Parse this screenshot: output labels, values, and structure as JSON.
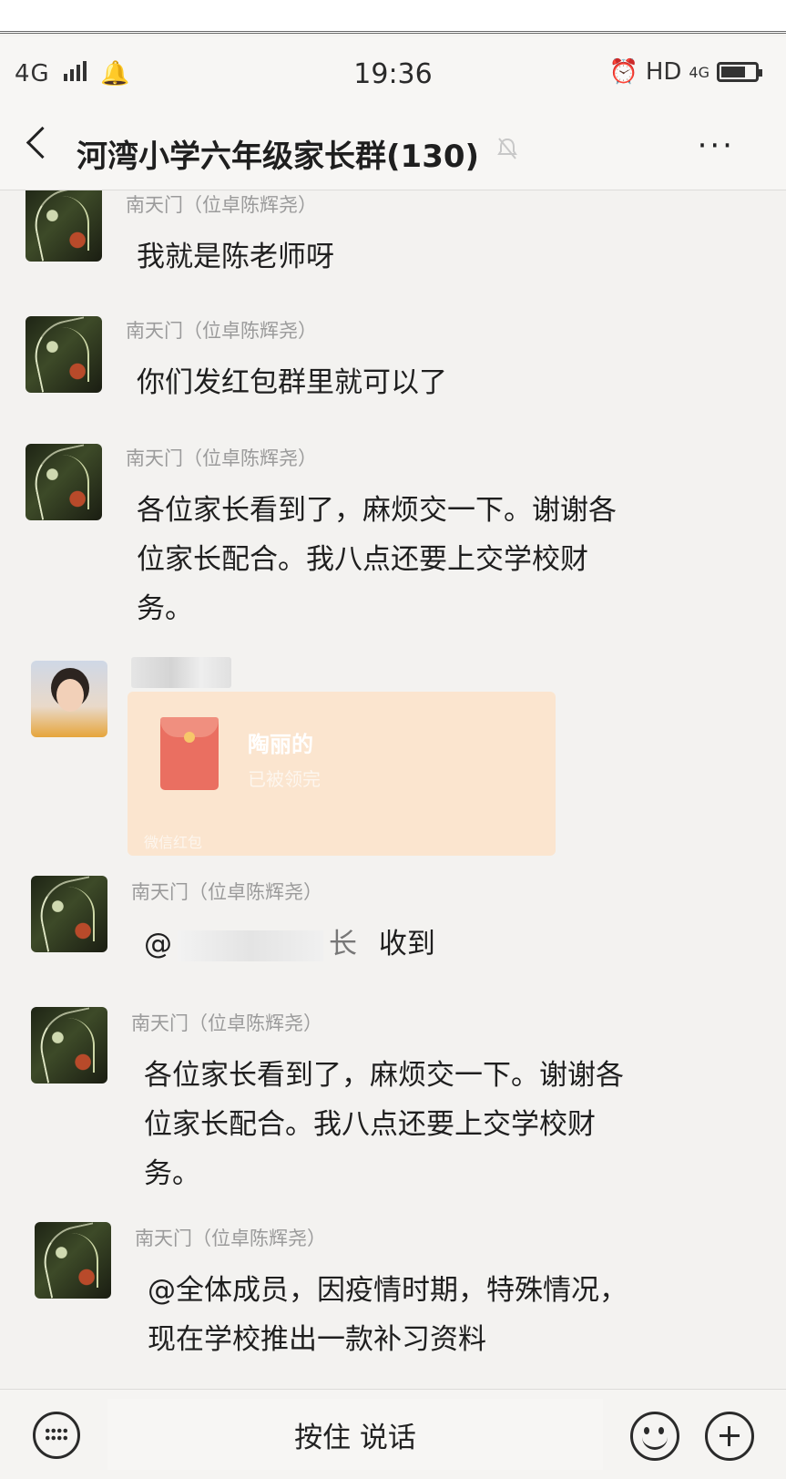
{
  "status_bar": {
    "network": "4G",
    "time": "19:36",
    "right_indicators": "HD",
    "right_network": "4G"
  },
  "header": {
    "title": "河湾小学六年级家长群(130)",
    "more_label": "···"
  },
  "messages": [
    {
      "sender": "南天门（位卓陈辉尧）",
      "text": "我就是陈老师呀"
    },
    {
      "sender": "南天门（位卓陈辉尧）",
      "text": "你们发红包群里就可以了"
    },
    {
      "sender": "南天门（位卓陈辉尧）",
      "text": "各位家长看到了，麻烦交一下。谢谢各位家长配合。我八点还要上交学校财务。"
    },
    {
      "sender": "",
      "red_packet": {
        "title": "陶丽的",
        "subtitle": "已被领完",
        "footer": "微信红包"
      }
    },
    {
      "sender": "南天门（位卓陈辉尧）",
      "at_prefix": "@",
      "at_suffix": "长",
      "text": "收到"
    },
    {
      "sender": "南天门（位卓陈辉尧）",
      "text": "各位家长看到了，麻烦交一下。谢谢各位家长配合。我八点还要上交学校财务。"
    },
    {
      "sender": "南天门（位卓陈辉尧）",
      "text": "@全体成员，因疫情时期，特殊情况，现在学校推出一款补习资料"
    }
  ],
  "input_bar": {
    "voice_label": "按住 说话",
    "icons": [
      "keyboard-icon",
      "emoji-icon",
      "plus-icon"
    ]
  },
  "colors": {
    "background": "#f3f2f0",
    "sender_gray": "#9b9b9b",
    "red_packet": "#fbe5cf"
  }
}
